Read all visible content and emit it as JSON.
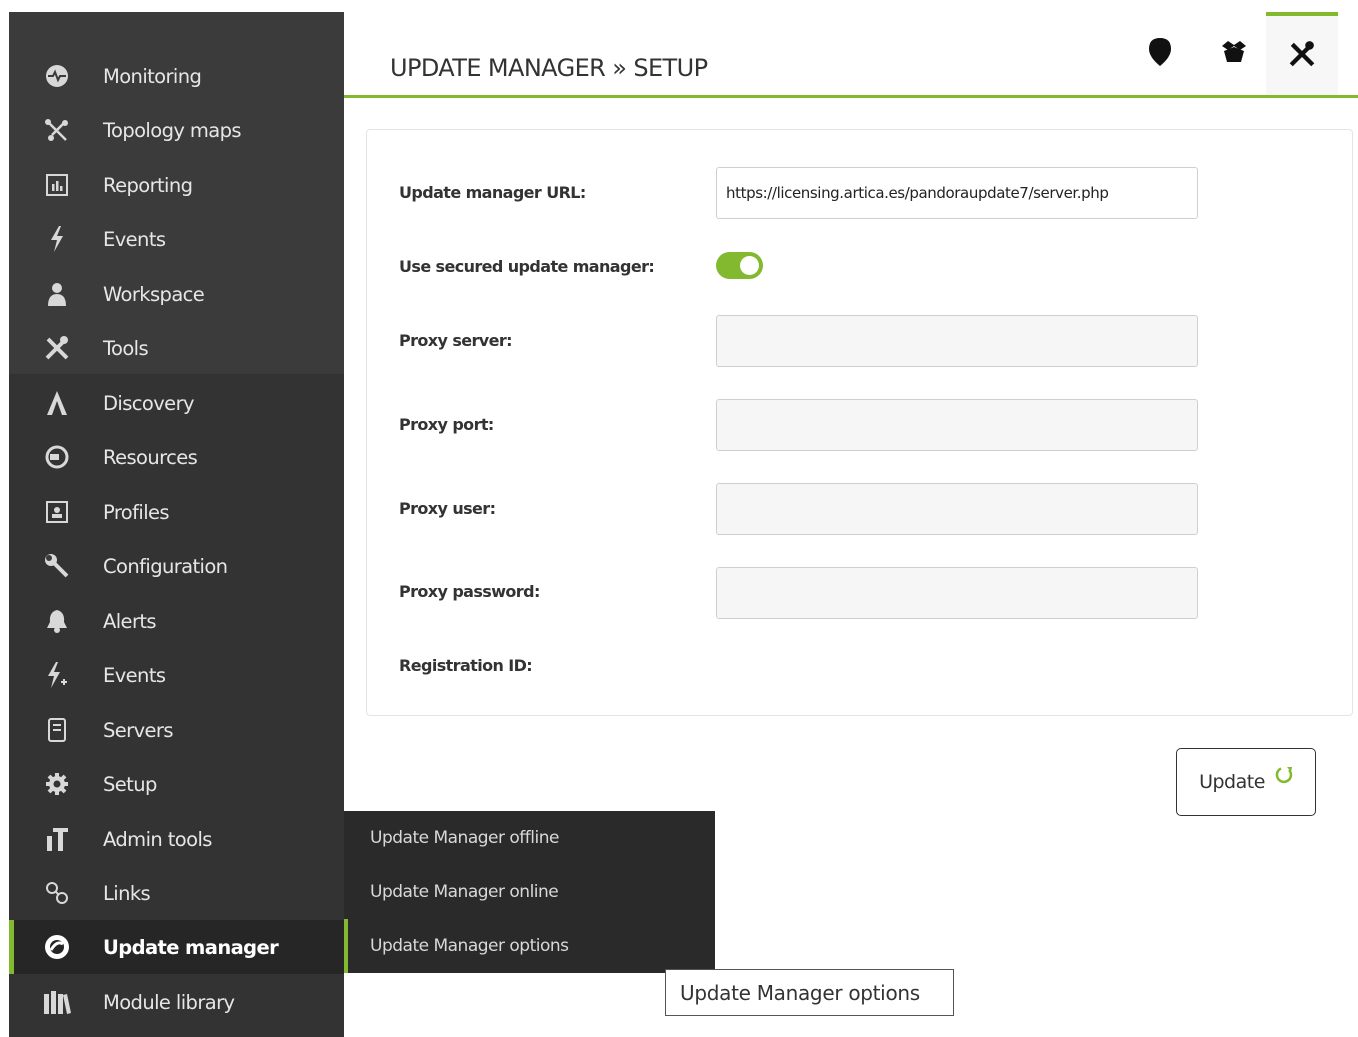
{
  "sidebar": {
    "items": [
      {
        "label": "Monitoring",
        "icon": "heartbeat-icon"
      },
      {
        "label": "Topology maps",
        "icon": "topology-icon"
      },
      {
        "label": "Reporting",
        "icon": "report-icon"
      },
      {
        "label": "Events",
        "icon": "lightning-icon"
      },
      {
        "label": "Workspace",
        "icon": "user-icon"
      },
      {
        "label": "Tools",
        "icon": "tools-icon"
      },
      {
        "label": "Discovery",
        "icon": "discovery-icon"
      },
      {
        "label": "Resources",
        "icon": "resources-icon"
      },
      {
        "label": "Profiles",
        "icon": "profile-icon"
      },
      {
        "label": "Configuration",
        "icon": "wrench-icon"
      },
      {
        "label": "Alerts",
        "icon": "bell-icon"
      },
      {
        "label": "Events",
        "icon": "lightning-plus-icon"
      },
      {
        "label": "Servers",
        "icon": "server-icon"
      },
      {
        "label": "Setup",
        "icon": "gear-icon"
      },
      {
        "label": "Admin tools",
        "icon": "admin-tools-icon"
      },
      {
        "label": "Links",
        "icon": "link-icon"
      },
      {
        "label": "Update manager",
        "icon": "update-manager-icon"
      },
      {
        "label": "Module library",
        "icon": "library-icon"
      }
    ]
  },
  "header": {
    "title": "UPDATE MANAGER » SETUP",
    "buttons": [
      "location-pin-icon",
      "box-icon",
      "tools-icon"
    ]
  },
  "form": {
    "url_label": "Update manager URL:",
    "url_value": "https://licensing.artica.es/pandoraupdate7/server.php",
    "secured_label": "Use secured update manager:",
    "secured_on": true,
    "proxy_server_label": "Proxy server:",
    "proxy_server_value": "",
    "proxy_port_label": "Proxy port:",
    "proxy_port_value": "",
    "proxy_user_label": "Proxy user:",
    "proxy_user_value": "",
    "proxy_password_label": "Proxy password:",
    "proxy_password_value": "",
    "registration_label": "Registration ID:"
  },
  "update_button": {
    "label": "Update"
  },
  "submenu": {
    "items": [
      "Update Manager offline",
      "Update Manager online",
      "Update Manager options"
    ]
  },
  "tooltip": {
    "text": "Update Manager options"
  },
  "colors": {
    "accent": "#82b92e",
    "sidebar": "#3b3b3b",
    "sidebar_admin": "#333333",
    "submenu": "#2a2a2a"
  }
}
